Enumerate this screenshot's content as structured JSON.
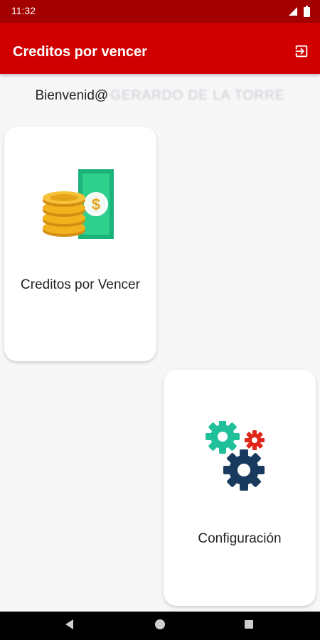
{
  "status_bar": {
    "time": "11:32",
    "icons": [
      "signal-icon",
      "battery-icon"
    ]
  },
  "app_bar": {
    "title": "Creditos por vencer",
    "action_icon": "logout-icon"
  },
  "welcome": {
    "prefix": "Bienvenid@",
    "name": "GERARDO DE LA TORRE"
  },
  "cards": [
    {
      "label": "Creditos por Vencer",
      "icon": "money-coins-icon"
    },
    {
      "label": "Configuración",
      "icon": "gears-icon"
    }
  ],
  "colors": {
    "status_bar": "#a30000",
    "app_bar": "#d00000",
    "background": "#f7f7f7",
    "card": "#ffffff"
  },
  "nav_bar": {
    "buttons": [
      "back-icon",
      "home-icon",
      "recents-icon"
    ]
  }
}
